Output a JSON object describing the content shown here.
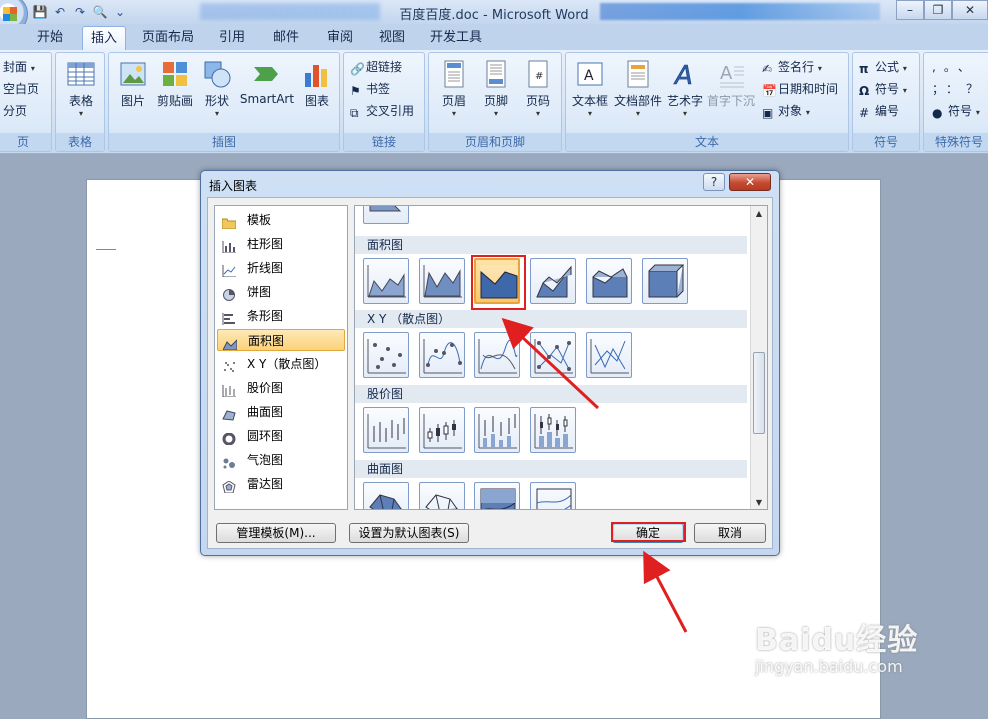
{
  "window": {
    "title": "百度百度.doc - Microsoft Word",
    "controls": [
      "–",
      "❐",
      "✕"
    ]
  },
  "tabs": [
    "开始",
    "插入",
    "页面布局",
    "引用",
    "邮件",
    "审阅",
    "视图",
    "开发工具"
  ],
  "active_tab": "插入",
  "ribbon": {
    "pages_group": {
      "items": [
        "封面",
        "空白页",
        "分页"
      ],
      "label": "页"
    },
    "table_group": {
      "button": "表格",
      "label": "表格"
    },
    "illustration_group": {
      "buttons": [
        "图片",
        "剪贴画",
        "形状",
        "SmartArt",
        "图表"
      ],
      "label": "插图"
    },
    "links_group": {
      "items": [
        "超链接",
        "书签",
        "交叉引用"
      ],
      "label": "链接"
    },
    "header_footer_group": {
      "buttons": [
        "页眉",
        "页脚",
        "页码"
      ],
      "label": "页眉和页脚"
    },
    "text_group": {
      "buttons": [
        "文本框",
        "文档部件",
        "艺术字",
        "首字下沉"
      ],
      "items": [
        "签名行",
        "日期和时间",
        "对象"
      ],
      "label": "文本"
    },
    "symbols_group": {
      "items": [
        "公式",
        "符号",
        "编号"
      ],
      "label": "符号"
    },
    "special_group": {
      "items": [
        "符号"
      ],
      "label": "特殊符号",
      "punct": [
        ",",
        "。",
        "、",
        "；",
        "：",
        "？"
      ]
    }
  },
  "dialog": {
    "title": "插入图表",
    "help": "?",
    "close": "✕",
    "categories": [
      {
        "label": "模板",
        "icon": "folder-icon"
      },
      {
        "label": "柱形图",
        "icon": "column-chart-icon"
      },
      {
        "label": "折线图",
        "icon": "line-chart-icon"
      },
      {
        "label": "饼图",
        "icon": "pie-chart-icon"
      },
      {
        "label": "条形图",
        "icon": "bar-chart-icon"
      },
      {
        "label": "面积图",
        "icon": "area-chart-icon"
      },
      {
        "label": "X Y（散点图）",
        "icon": "scatter-chart-icon"
      },
      {
        "label": "股价图",
        "icon": "stock-chart-icon"
      },
      {
        "label": "曲面图",
        "icon": "surface-chart-icon"
      },
      {
        "label": "圆环图",
        "icon": "doughnut-chart-icon"
      },
      {
        "label": "气泡图",
        "icon": "bubble-chart-icon"
      },
      {
        "label": "雷达图",
        "icon": "radar-chart-icon"
      }
    ],
    "selected_category": "面积图",
    "sections": [
      "面积图",
      "X Y （散点图）",
      "股价图",
      "曲面图"
    ],
    "selected_thumbnail": "stacked-area",
    "manage_templates": "管理模板(M)...",
    "set_default": "设置为默认图表(S)",
    "ok": "确定",
    "cancel": "取消"
  },
  "annotation_color": "#e02020",
  "watermark": {
    "main": "Baidu经验",
    "sub": "jingyan.baidu.com"
  }
}
